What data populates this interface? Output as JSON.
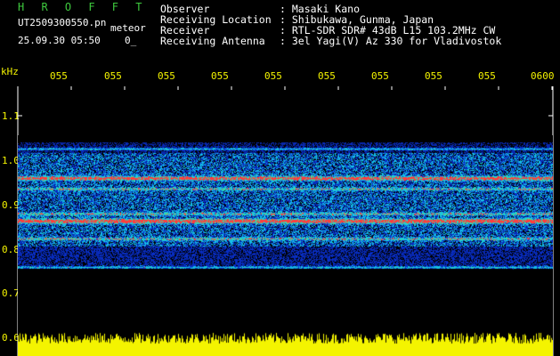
{
  "header": {
    "title": "H R O F F T",
    "filename": "UT2509300550.pn",
    "label_meteor": "meteor",
    "datetime": "25.09.30 05:50",
    "zero": "0_"
  },
  "info": [
    {
      "label": "Observer",
      "value": ": Masaki Kano"
    },
    {
      "label": "Receiving Location",
      "value": ": Shibukawa, Gunma, Japan"
    },
    {
      "label": "Receiver",
      "value": ": RTL-SDR SDR# 43dB L15 103.2MHz CW"
    },
    {
      "label": "Receiving Antenna",
      "value": ": 3el Yagi(V) Az 330 for Vladivostok"
    }
  ],
  "axis": {
    "y_unit": "kHz",
    "y_ticks": [
      "1.1",
      "1.0",
      "0.9",
      "0.8",
      "0.7",
      "0.6"
    ],
    "x_ticks": [
      "055",
      "055",
      "055",
      "055",
      "055",
      "055",
      "055",
      "055",
      "055",
      "0600"
    ]
  },
  "colors": {
    "background": "#000000",
    "title": "#3ec93e",
    "info_text": "#ffffff",
    "axis_text": "#f4f400",
    "signal_low": "#0a1f9e",
    "signal_mid": "#19a7f0",
    "signal_high": "#ff2a2a"
  }
}
